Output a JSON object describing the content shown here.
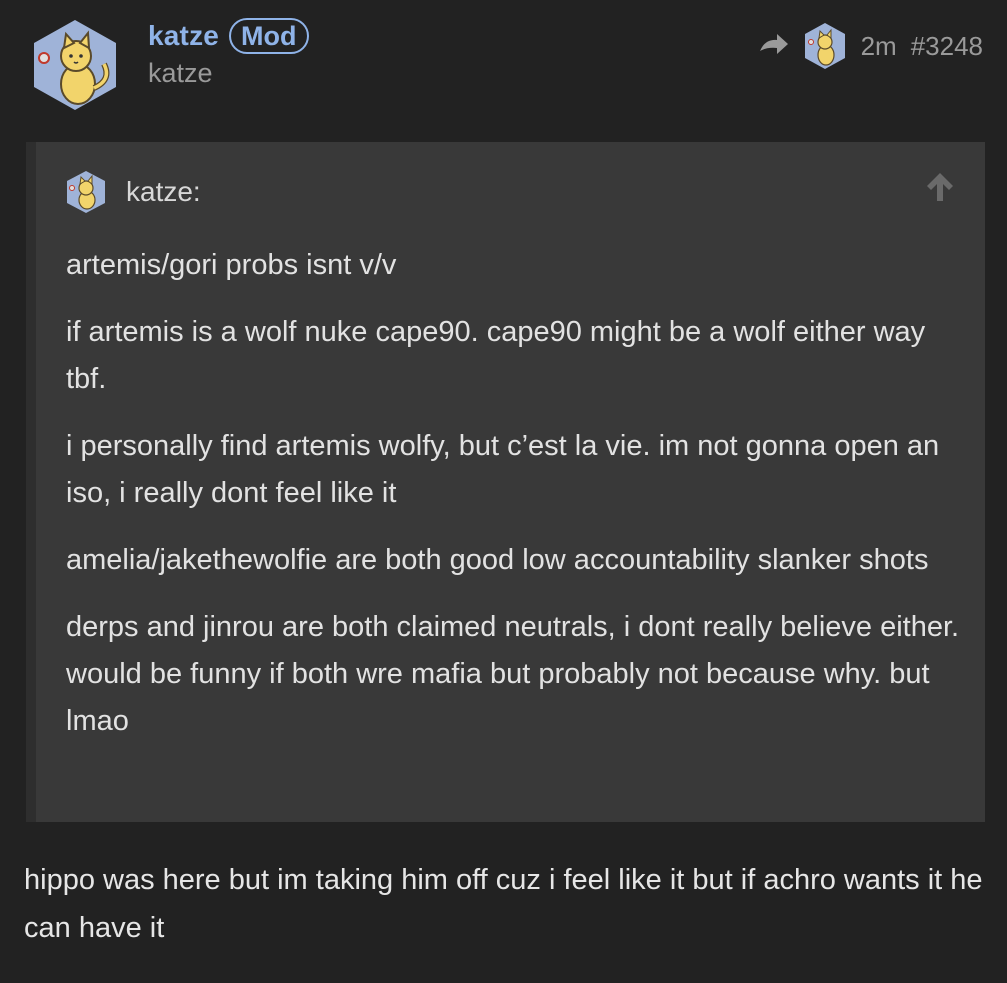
{
  "post": {
    "username": "katze",
    "badge": "Mod",
    "subname": "katze",
    "time_ago": "2m",
    "post_number": "#3248",
    "avatar_icon": "cat-avatar-icon",
    "reply_icon": "reply-arrow-icon"
  },
  "quote": {
    "author": "katze:",
    "jump_icon": "arrow-up-icon",
    "paragraphs": [
      "artemis/gori probs isnt v/v",
      "if artemis is a wolf nuke cape90. cape90 might be a wolf either way tbf.",
      "i personally find artemis wolfy, but c’est la vie. im not gonna open an iso, i really dont feel like it",
      "amelia/jakethewolfie are both good low accountability slanker shots",
      "derps and jinrou are both claimed neutrals, i dont really believe either. would be funny if both wre mafia but probably not because why. but lmao"
    ]
  },
  "body": {
    "text": "hippo was here but im taking him off cuz i feel like it but if achro wants it he can have it"
  },
  "colors": {
    "background": "#222222",
    "quote_background": "#393939",
    "accent": "#8fb3e8",
    "avatar_hex": "#9fb3d8",
    "muted": "#9a9a9a"
  }
}
